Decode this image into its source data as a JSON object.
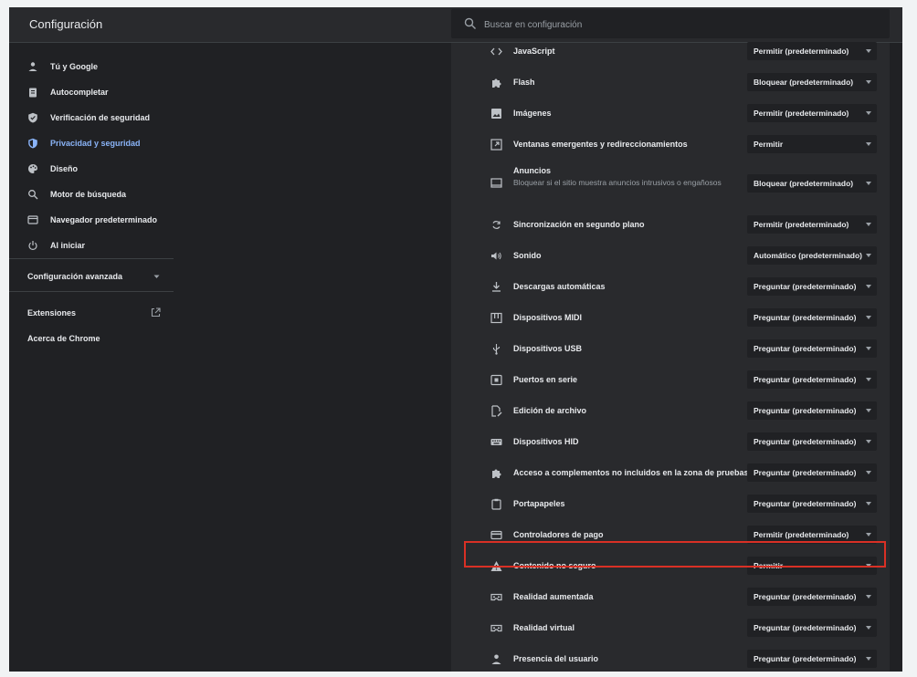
{
  "header": {
    "title": "Configuración",
    "search_placeholder": "Buscar en configuración"
  },
  "sidebar": {
    "items": [
      {
        "label": "Tú y Google",
        "icon": "person-icon"
      },
      {
        "label": "Autocompletar",
        "icon": "clipboard-icon"
      },
      {
        "label": "Verificación de seguridad",
        "icon": "shield-check-icon"
      },
      {
        "label": "Privacidad y seguridad",
        "icon": "shield-icon",
        "active": true
      },
      {
        "label": "Diseño",
        "icon": "palette-icon"
      },
      {
        "label": "Motor de búsqueda",
        "icon": "search-icon"
      },
      {
        "label": "Navegador predeterminado",
        "icon": "browser-icon"
      },
      {
        "label": "Al iniciar",
        "icon": "power-icon"
      }
    ],
    "advanced": "Configuración avanzada",
    "extensions": "Extensiones",
    "about": "Acerca de Chrome"
  },
  "settings": [
    {
      "name": "JavaScript",
      "value": "Permitir (predeterminado)",
      "icon": "code-icon"
    },
    {
      "name": "Flash",
      "value": "Bloquear (predeterminado)",
      "icon": "puzzle-icon"
    },
    {
      "name": "Imágenes",
      "value": "Permitir (predeterminado)",
      "icon": "image-icon"
    },
    {
      "name": "Ventanas emergentes y redireccionamientos",
      "value": "Permitir",
      "icon": "popup-icon"
    },
    {
      "name": "Anuncios",
      "description": "Bloquear si el sitio muestra anuncios intrusivos o engañosos",
      "value": "Bloquear (predeterminado)",
      "icon": "ads-icon"
    },
    {
      "name": "Sincronización en segundo plano",
      "value": "Permitir (predeterminado)",
      "icon": "sync-icon"
    },
    {
      "name": "Sonido",
      "value": "Automático (predeterminado)",
      "icon": "speaker-icon"
    },
    {
      "name": "Descargas automáticas",
      "value": "Preguntar (predeterminado)",
      "icon": "download-icon"
    },
    {
      "name": "Dispositivos MIDI",
      "value": "Preguntar (predeterminado)",
      "icon": "piano-icon"
    },
    {
      "name": "Dispositivos USB",
      "value": "Preguntar (predeterminado)",
      "icon": "usb-icon"
    },
    {
      "name": "Puertos en serie",
      "value": "Preguntar (predeterminado)",
      "icon": "serial-port-icon"
    },
    {
      "name": "Edición de archivo",
      "value": "Preguntar (predeterminado)",
      "icon": "file-edit-icon"
    },
    {
      "name": "Dispositivos HID",
      "value": "Preguntar (predeterminado)",
      "icon": "keyboard-icon"
    },
    {
      "name": "Acceso a complementos no incluidos en la zona de pruebas",
      "value": "Preguntar (predeterminado)",
      "icon": "puzzle-icon"
    },
    {
      "name": "Portapapeles",
      "value": "Preguntar (predeterminado)",
      "icon": "clipboard-icon"
    },
    {
      "name": "Controladores de pago",
      "value": "Permitir (predeterminado)",
      "icon": "credit-card-icon"
    },
    {
      "name": "Contenido no seguro",
      "value": "Permitir",
      "icon": "warning-icon",
      "highlighted": true
    },
    {
      "name": "Realidad aumentada",
      "value": "Preguntar (predeterminado)",
      "icon": "vr-headset-icon"
    },
    {
      "name": "Realidad virtual",
      "value": "Preguntar (predeterminado)",
      "icon": "vr-headset-icon"
    },
    {
      "name": "Presencia del usuario",
      "value": "Preguntar (predeterminado)",
      "icon": "person-icon"
    }
  ],
  "colors": {
    "background": "#202124",
    "panel": "#292a2d",
    "accent": "#8ab4f8",
    "highlight_border": "#d93025"
  }
}
